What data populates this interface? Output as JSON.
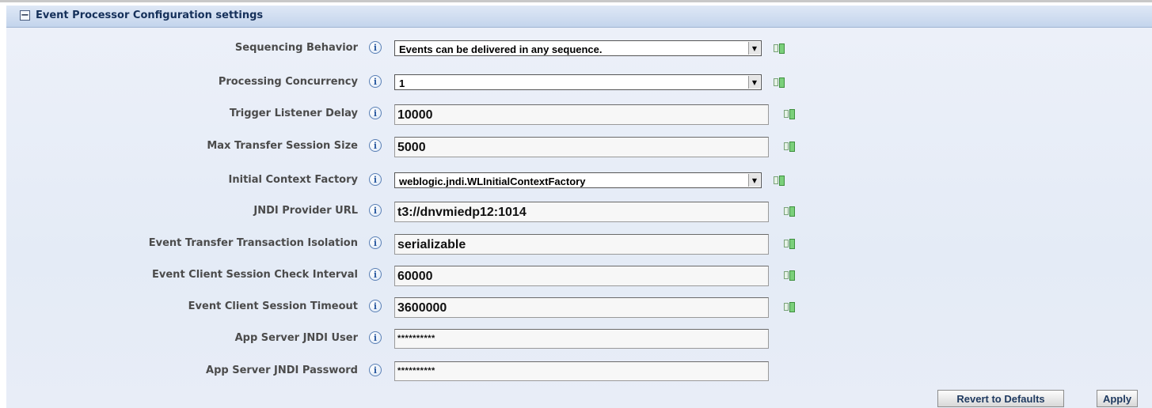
{
  "section": {
    "title": "Event Processor Configuration settings",
    "collapse_glyph": "−"
  },
  "info_glyph": "i",
  "fields": [
    {
      "label": "Sequencing Behavior",
      "type": "select",
      "value": "Events can be delivered in any sequence."
    },
    {
      "label": "Processing Concurrency",
      "type": "select",
      "value": "1"
    },
    {
      "label": "Trigger Listener Delay",
      "type": "text",
      "value": "10000"
    },
    {
      "label": "Max Transfer Session Size",
      "type": "text",
      "value": "5000"
    },
    {
      "label": "Initial Context Factory",
      "type": "select",
      "value": "weblogic.jndi.WLInitialContextFactory"
    },
    {
      "label": "JNDI Provider URL",
      "type": "text",
      "value": "t3://dnvmiedp12:1014"
    },
    {
      "label": "Event Transfer Transaction Isolation",
      "type": "text",
      "value": "serializable"
    },
    {
      "label": "Event Client Session Check Interval",
      "type": "text",
      "value": "60000"
    },
    {
      "label": "Event Client Session Timeout",
      "type": "text",
      "value": "3600000"
    },
    {
      "label": "App Server JNDI User",
      "type": "password",
      "value": "**********"
    },
    {
      "label": "App Server JNDI Password",
      "type": "password",
      "value": "**********"
    }
  ],
  "icons": {
    "info": "info-icon",
    "override": "override-icon",
    "dropdown": "chevron-down-icon",
    "collapse": "collapse-icon"
  },
  "colors": {
    "header_top": "#dfe8f6",
    "header_bottom": "#c3d4ec",
    "content_bg": "#e8edf7",
    "label_text": "#4b4b4b",
    "button_text": "#1f3a60"
  },
  "buttons": {
    "revert_label": "Revert to Defaults",
    "apply_label": "Apply"
  }
}
